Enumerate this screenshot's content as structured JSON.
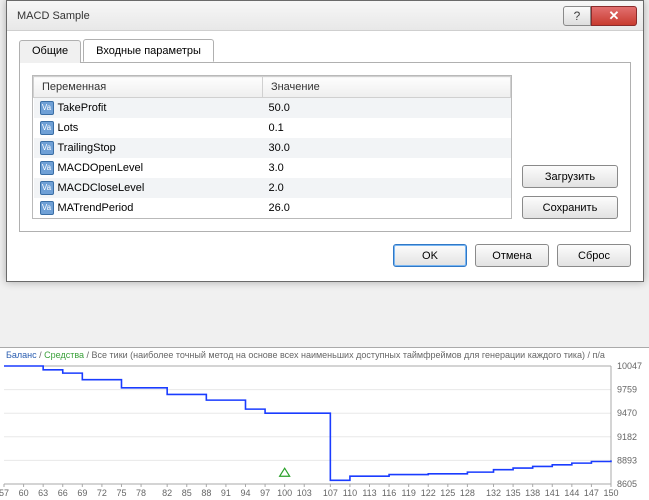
{
  "window": {
    "title": "MACD Sample",
    "help_glyph": "?",
    "close_glyph": "✕"
  },
  "tabs": {
    "general": "Общие",
    "inputs": "Входные параметры"
  },
  "grid": {
    "col_variable": "Переменная",
    "col_value": "Значение",
    "var_icon_text": "Va",
    "rows": [
      {
        "name": "TakeProfit",
        "value": "50.0"
      },
      {
        "name": "Lots",
        "value": "0.1"
      },
      {
        "name": "TrailingStop",
        "value": "30.0"
      },
      {
        "name": "MACDOpenLevel",
        "value": "3.0"
      },
      {
        "name": "MACDCloseLevel",
        "value": "2.0"
      },
      {
        "name": "MATrendPeriod",
        "value": "26.0"
      }
    ]
  },
  "buttons": {
    "load": "Загрузить",
    "save": "Сохранить",
    "ok": "OK",
    "cancel": "Отмена",
    "reset": "Сброс"
  },
  "chart_data": {
    "type": "line",
    "header_prefix": "Баланс",
    "header_sep": " / ",
    "header_funds": "Средства",
    "header_desc": "Все тики (наиболее точный метод на основе всех наименьших доступных таймфреймов для генерации каждого тика)",
    "header_suffix": "п/а",
    "x": [
      57,
      60,
      63,
      66,
      69,
      72,
      75,
      78,
      82,
      85,
      88,
      91,
      94,
      97,
      100,
      103,
      107,
      110,
      113,
      116,
      119,
      122,
      125,
      128,
      132,
      135,
      138,
      141,
      144,
      147,
      150
    ],
    "y": [
      10047,
      10047,
      10000,
      9960,
      9880,
      9880,
      9780,
      9780,
      9700,
      9700,
      9630,
      9630,
      9520,
      9470,
      9470,
      9470,
      8650,
      8700,
      8700,
      8720,
      8720,
      8730,
      8730,
      8750,
      8780,
      8800,
      8820,
      8840,
      8860,
      8880,
      8893
    ],
    "xlim": [
      57,
      150
    ],
    "ylim": [
      8605,
      10047
    ],
    "yticks": [
      10047,
      9759,
      9470,
      9182,
      8893,
      8605
    ],
    "xticks": [
      57,
      60,
      63,
      66,
      69,
      72,
      75,
      78,
      82,
      85,
      88,
      91,
      94,
      97,
      100,
      103,
      107,
      110,
      113,
      116,
      119,
      122,
      125,
      128,
      132,
      135,
      138,
      141,
      144,
      147,
      150
    ],
    "marker_x": 100
  }
}
